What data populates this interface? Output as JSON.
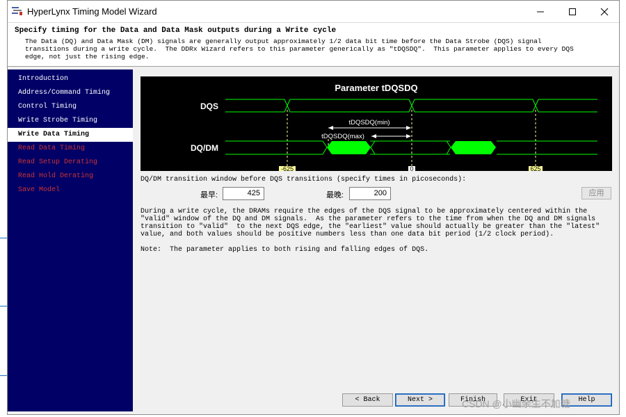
{
  "window": {
    "title": "HyperLynx Timing Model Wizard",
    "controls": {
      "minimize": "minimize-icon",
      "maximize": "maximize-icon",
      "close": "close-icon"
    }
  },
  "header": {
    "title": "Specify timing for the Data and Data Mask outputs during a Write cycle",
    "description": "The Data (DQ) and Data Mask (DM) signals are generally output approximately 1/2 data bit time before the Data Strobe (DQS) signal\ntransitions during a write cycle.  The DDRx Wizard refers to this parameter generically as \"tDQSDQ\".  This parameter applies to every DQS\nedge, not just the rising edge."
  },
  "sidebar": {
    "items": [
      {
        "label": "Introduction",
        "state": "normal"
      },
      {
        "label": "Address/Command Timing",
        "state": "normal"
      },
      {
        "label": "Control Timing",
        "state": "normal"
      },
      {
        "label": "Write Strobe Timing",
        "state": "normal"
      },
      {
        "label": "Write Data Timing",
        "state": "selected"
      },
      {
        "label": "Read Data Timing",
        "state": "disabled"
      },
      {
        "label": "Read Setup Derating",
        "state": "disabled"
      },
      {
        "label": "Read Hold Derating",
        "state": "disabled"
      },
      {
        "label": "Save Model",
        "state": "disabled"
      }
    ]
  },
  "diagram": {
    "title": "Parameter tDQSDQ",
    "signal_dqs": "DQS",
    "signal_dqdm": "DQ/DM",
    "arrow_min": "tDQSDQ(min)",
    "arrow_max": "tDQSDQ(max)",
    "tick_left": "-625",
    "tick_center": "0",
    "tick_right": "625",
    "colors": {
      "background": "#000000",
      "trace": "#00ff00",
      "marker": "#ffff99",
      "text": "#ffffff"
    }
  },
  "form": {
    "window_label": "DQ/DM transition window before DQS transitions (specify times in picoseconds):",
    "earliest_label": "最早:",
    "earliest_value": "425",
    "latest_label": "最晚:",
    "latest_value": "200",
    "apply_label": "应用"
  },
  "notes": {
    "paragraph": "During a write cycle, the DRAMs require the edges of the DQS signal to be approximately centered within the\n\"valid\" window of the DQ and DM signals.  As the parameter refers to the time from when the DQ and DM signals\ntransition to \"valid\"  to the next DQS edge, the \"earliest\" value should actually be greater than the \"latest\"\nvalue, and both values should be positive numbers less than one data bit period (1/2 clock period).",
    "note": "Note:  The parameter applies to both rising and falling edges of DQS."
  },
  "footer": {
    "back_label": "< Back",
    "next_label": "Next >",
    "finish_label": "Finish",
    "exit_label": "Exit",
    "help_label": "Help",
    "watermark": "CSDN @小幽余生不加糖"
  }
}
